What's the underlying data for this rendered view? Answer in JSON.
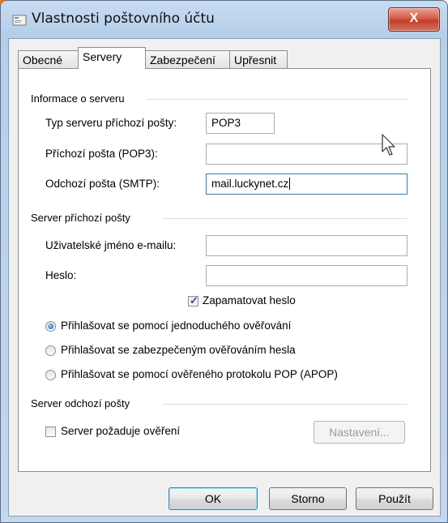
{
  "window": {
    "title": "Vlastnosti poštovního účtu",
    "close_label": "X"
  },
  "tabs": [
    "Obecné",
    "Servery",
    "Zabezpečení",
    "Upřesnit"
  ],
  "active_tab": "Servery",
  "server_info": {
    "group_label": "Informace o serveru",
    "type_label": "Typ serveru příchozí pošty:",
    "type_value": "POP3",
    "incoming_label": "Příchozí pošta (POP3):",
    "incoming_value": "",
    "outgoing_label": "Odchozí pošta (SMTP):",
    "outgoing_value": "mail.luckynet.cz"
  },
  "incoming_server": {
    "group_label": "Server příchozí pošty",
    "username_label": "Uživatelské jméno e-mailu:",
    "username_value": "",
    "password_label": "Heslo:",
    "password_value": "",
    "remember_label": "Zapamatovat heslo",
    "remember_checked": true,
    "auth_options": [
      {
        "label": "Přihlašovat se pomocí jednoduchého ověřování",
        "checked": true
      },
      {
        "label": "Přihlašovat se zabezpečeným ověřováním hesla",
        "checked": false
      },
      {
        "label": "Přihlašovat se pomocí ověřeného protokolu POP (APOP)",
        "checked": false
      }
    ]
  },
  "outgoing_server": {
    "group_label": "Server odchozí pošty",
    "requires_auth_label": "Server požaduje ověření",
    "requires_auth_checked": false,
    "settings_button": "Nastavení..."
  },
  "footer": {
    "ok": "OK",
    "cancel": "Storno",
    "apply": "Použít"
  },
  "colors": {
    "accent": "#f07a18",
    "close_button": "#c13d29",
    "focus_border": "#3d7bad"
  }
}
